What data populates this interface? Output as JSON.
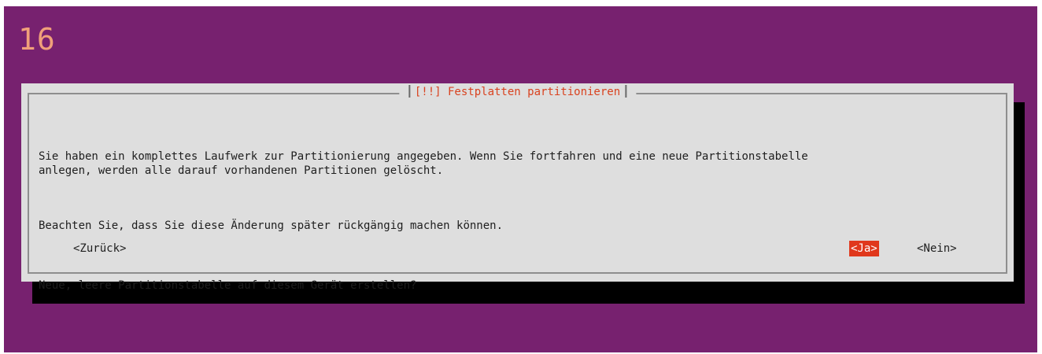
{
  "screen": {
    "step_number": "16",
    "background_color": "#77216f"
  },
  "dialog": {
    "title": "[!!] Festplatten partitionieren",
    "title_color": "#d9421f",
    "paragraphs": [
      "Sie haben ein komplettes Laufwerk zur Partitionierung angegeben. Wenn Sie fortfahren und eine neue Partitionstabelle\nanlegen, werden alle darauf vorhandenen Partitionen gelöscht.",
      "Beachten Sie, dass Sie diese Änderung später rückgängig machen können.",
      "Neue, leere Partitionstabelle auf diesem Gerät erstellen?"
    ],
    "buttons": {
      "back": "<Zurück>",
      "yes": "<Ja>",
      "no": "<Nein>"
    },
    "selected_button": "yes",
    "highlight_color": "#e0381c"
  }
}
